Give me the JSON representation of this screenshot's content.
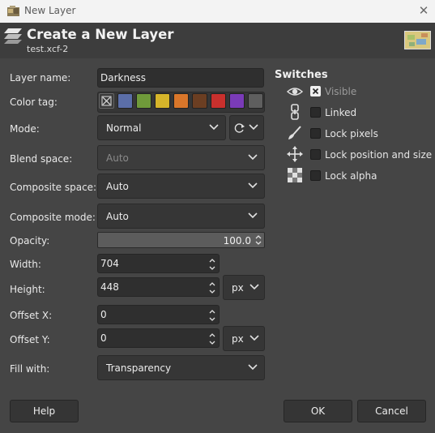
{
  "window": {
    "title": "New Layer",
    "close_glyph": "✕"
  },
  "header": {
    "title": "Create a New Layer",
    "subtitle": "test.xcf-2"
  },
  "form": {
    "layer_name_label": "Layer name:",
    "layer_name_value": "Darkness",
    "color_tag_label": "Color tag:",
    "color_tags": [
      "none",
      "#5b6ea8",
      "#6f9a3a",
      "#d6b52a",
      "#d9762a",
      "#6b3e22",
      "#c9302d",
      "#7a3bb8",
      "#5e5e5e"
    ],
    "mode_label": "Mode:",
    "mode_value": "Normal",
    "blend_space_label": "Blend space:",
    "blend_space_value": "Auto",
    "composite_space_label": "Composite space:",
    "composite_space_value": "Auto",
    "composite_mode_label": "Composite mode:",
    "composite_mode_value": "Auto",
    "opacity_label": "Opacity:",
    "opacity_value": "100.0",
    "width_label": "Width:",
    "width_value": "704",
    "height_label": "Height:",
    "height_value": "448",
    "size_unit": "px",
    "offset_x_label": "Offset X:",
    "offset_x_value": "0",
    "offset_y_label": "Offset Y:",
    "offset_y_value": "0",
    "offset_unit": "px",
    "fill_label": "Fill with:",
    "fill_value": "Transparency"
  },
  "switches": {
    "title": "Switches",
    "items": [
      {
        "label": "Visible",
        "icon": "eye-icon",
        "checked": true
      },
      {
        "label": "Linked",
        "icon": "chain-icon",
        "checked": false
      },
      {
        "label": "Lock pixels",
        "icon": "brush-icon",
        "checked": false
      },
      {
        "label": "Lock position and size",
        "icon": "move-icon",
        "checked": false
      },
      {
        "label": "Lock alpha",
        "icon": "checkerboard-icon",
        "checked": false
      }
    ]
  },
  "buttons": {
    "help": "Help",
    "ok": "OK",
    "cancel": "Cancel"
  }
}
